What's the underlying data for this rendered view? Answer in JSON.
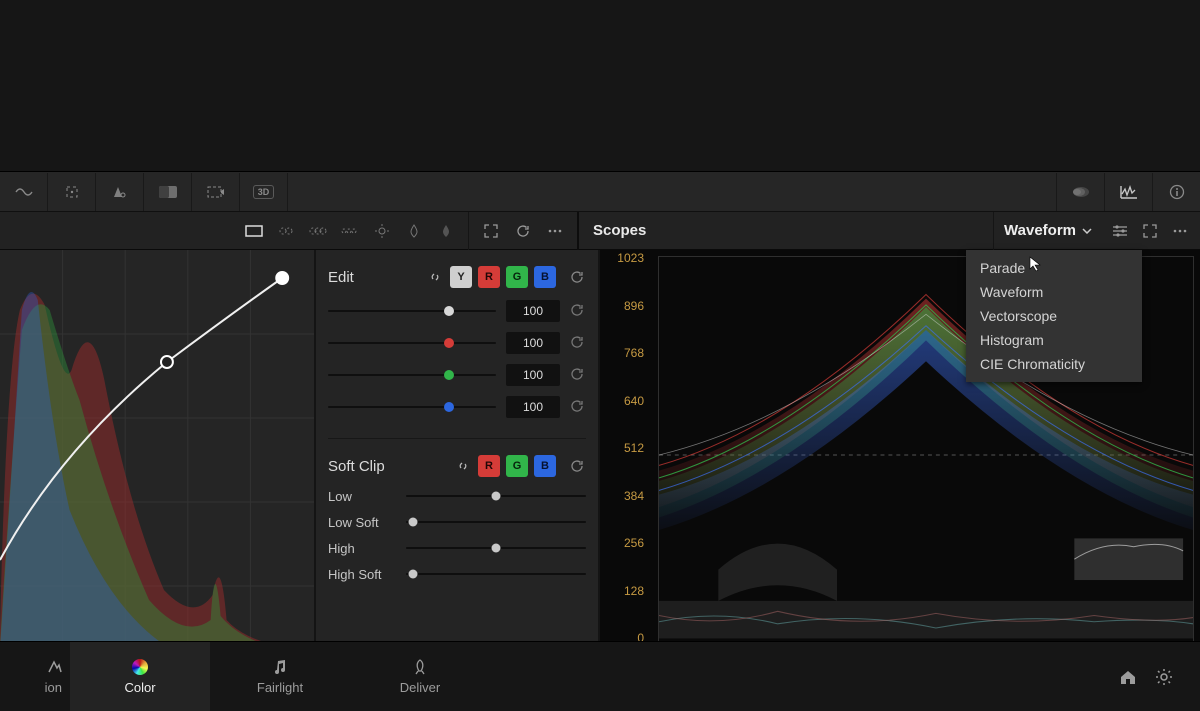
{
  "mid_toolbar": {
    "scopes_title": "Scopes",
    "scopes_dropdown_label": "Waveform",
    "scopes_menu": [
      "Parade",
      "Waveform",
      "Vectorscope",
      "Histogram",
      "CIE Chromaticity"
    ]
  },
  "edit": {
    "title": "Edit",
    "sliders": [
      {
        "value": "100",
        "dot": "dot-white",
        "pos": 72
      },
      {
        "value": "100",
        "dot": "dot-red",
        "pos": 72
      },
      {
        "value": "100",
        "dot": "dot-green",
        "pos": 72
      },
      {
        "value": "100",
        "dot": "dot-blue",
        "pos": 72
      }
    ]
  },
  "softclip": {
    "title": "Soft Clip",
    "rows": [
      {
        "label": "Low",
        "pos": 50
      },
      {
        "label": "Low Soft",
        "pos": 4
      },
      {
        "label": "High",
        "pos": 50
      },
      {
        "label": "High Soft",
        "pos": 4
      }
    ]
  },
  "scopes_axis": [
    "1023",
    "896",
    "768",
    "640",
    "512",
    "384",
    "256",
    "128",
    "0"
  ],
  "footer": {
    "partial": "ion",
    "color": "Color",
    "fairlight": "Fairlight",
    "deliver": "Deliver"
  },
  "colors": {
    "red": "#d53c38",
    "green": "#31b54a",
    "blue": "#2c67e0",
    "axis": "#c69a43"
  }
}
